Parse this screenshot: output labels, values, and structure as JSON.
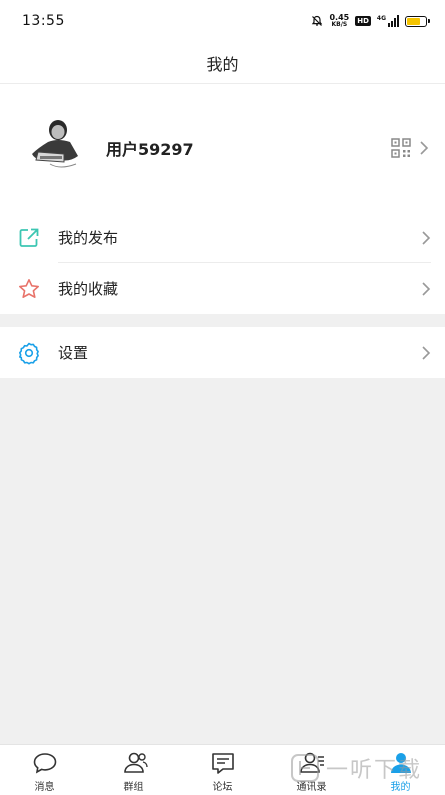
{
  "status_bar": {
    "time": "13:55",
    "net_speed_value": "0.45",
    "net_speed_unit": "KB/S",
    "hd_label": "HD",
    "network_label": "4G",
    "battery_level": 0.7,
    "battery_color": "#f5c400"
  },
  "header": {
    "title": "我的"
  },
  "profile": {
    "username": "用户59297",
    "avatar_icon": "user-photo",
    "qr_icon": "qrcode-icon"
  },
  "menu": {
    "publish_label": "我的发布",
    "favorites_label": "我的收藏",
    "settings_label": "设置"
  },
  "tabs": [
    {
      "label": "消息",
      "icon": "chat-bubble-icon"
    },
    {
      "label": "群组",
      "icon": "group-icon"
    },
    {
      "label": "论坛",
      "icon": "forum-icon"
    },
    {
      "label": "通讯录",
      "icon": "contacts-icon"
    },
    {
      "label": "我的",
      "icon": "profile-icon"
    }
  ],
  "active_tab": 4,
  "colors": {
    "accent": "#1aa0e8",
    "publish_icon": "#3cc6b2",
    "favorites_icon": "#e8736a",
    "settings_icon": "#1aa0e8"
  },
  "watermark": {
    "text": "一听下载"
  }
}
